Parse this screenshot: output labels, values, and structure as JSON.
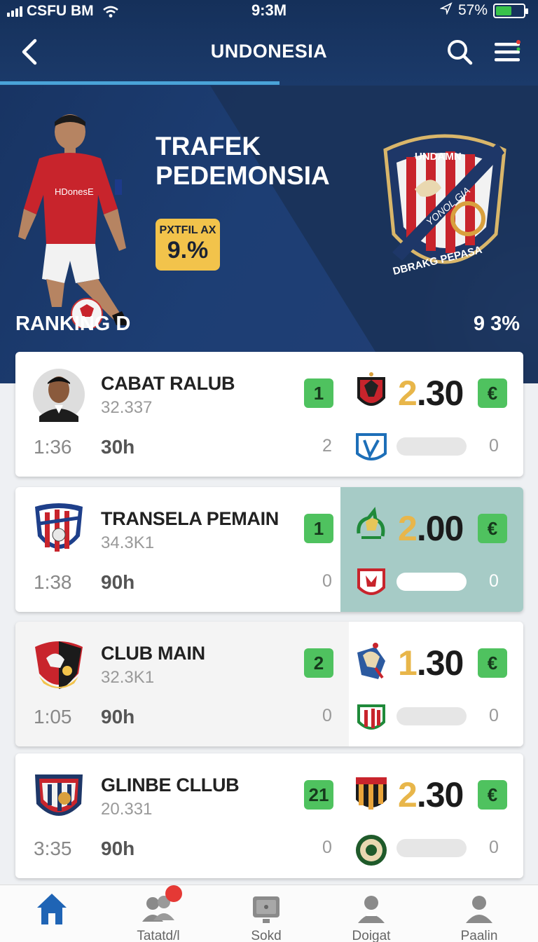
{
  "status": {
    "carrier": "CSFU BM",
    "time": "9:3M",
    "battery": "57%",
    "battery_level": 0.57,
    "battery_color": "#38c24a"
  },
  "header": {
    "title": "UNDONESIA",
    "back_icon": "chevron-left-icon",
    "search_icon": "search-icon",
    "menu_icon": "menu-icon",
    "tab_progress": 0.52
  },
  "hero": {
    "title_line1": "TRAFEK",
    "title_line2": "PEDEMONSIA",
    "badge_label": "PXTFIL AX",
    "badge_value": "9.%",
    "ranking": "RANKING D",
    "percent": "9 3%",
    "crest_top": "UNDAMN",
    "crest_mid": "YONOL GIA",
    "crest_bottom": "DBRAKG PEPASA"
  },
  "matches": [
    {
      "name": "CABAT RALUB",
      "sub": "32.337",
      "time": "1:36",
      "dur": "30h",
      "rank": "1",
      "mini": "2",
      "odds_int": "2",
      "odds_dec": ".30",
      "arrow": "€",
      "zero": "0",
      "highlight": "none"
    },
    {
      "name": "TRANSELA PEMAIN",
      "sub": "34.3K1",
      "time": "1:38",
      "dur": "90h",
      "rank": "1",
      "mini": "0",
      "odds_int": "2",
      "odds_dec": ".00",
      "arrow": "€",
      "zero": "0",
      "highlight": "teal"
    },
    {
      "name": "CLUB MAIN",
      "sub": "32.3K1",
      "time": "1:05",
      "dur": "90h",
      "rank": "2",
      "mini": "0",
      "odds_int": "1",
      "odds_dec": ".30",
      "arrow": "€",
      "zero": "0",
      "highlight": "grey"
    },
    {
      "name": "GLINBE CLLUB",
      "sub": "20.331",
      "time": "3:35",
      "dur": "90h",
      "rank": "21",
      "mini": "0",
      "odds_int": "2",
      "odds_dec": ".30",
      "arrow": "€",
      "zero": "0",
      "highlight": "none"
    }
  ],
  "bottom_nav": [
    {
      "label": "",
      "icon": "home-icon",
      "active": true
    },
    {
      "label": "Tatatd/l",
      "icon": "users-icon",
      "badge": true
    },
    {
      "label": "Sokd",
      "icon": "tv-icon"
    },
    {
      "label": "Doigat",
      "icon": "profile-icon"
    },
    {
      "label": "Paalin",
      "icon": "person-icon"
    }
  ],
  "colors": {
    "header": "#15305a",
    "accent_green": "#4fc25f",
    "odds_gold": "#e8b64a",
    "badge_yellow": "#f2c34b",
    "tab_line": "#4aa3d8",
    "notification": "#e53935"
  }
}
